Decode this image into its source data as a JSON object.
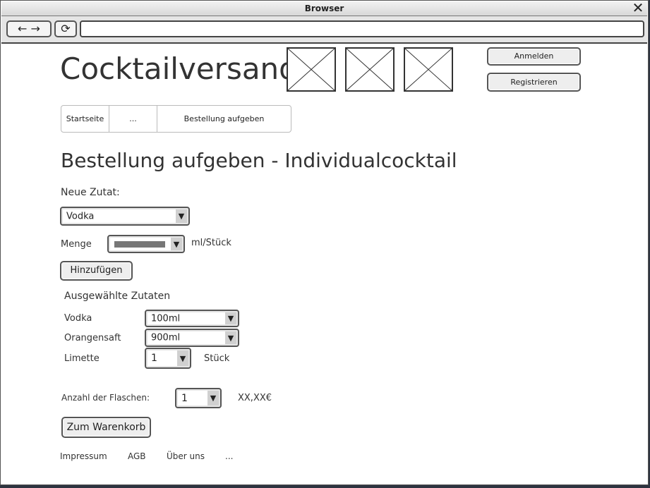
{
  "browser": {
    "title": "Browser",
    "close_glyph": "✕",
    "back_glyph": "←",
    "forward_glyph": "→",
    "reload_glyph": "⟳",
    "url": ""
  },
  "header": {
    "logo": "Cocktailversand",
    "login": "Anmelden",
    "register": "Registrieren"
  },
  "nav": {
    "items": [
      "Startseite",
      "...",
      "Bestellung aufgeben"
    ]
  },
  "main": {
    "title": "Bestellung aufgeben - Individualcocktail",
    "new_ingredient_label": "Neue Zutat:",
    "ingredient_select": "Vodka",
    "amount_label": "Menge",
    "amount_unit": "ml/Stück",
    "add_button": "Hinzufügen",
    "selected_title": "Ausgewählte Zutaten",
    "selected": [
      {
        "name": "Vodka",
        "amount": "100ml",
        "unit": ""
      },
      {
        "name": "Orangensaft",
        "amount": "900ml",
        "unit": ""
      },
      {
        "name": "Limette",
        "amount": "1",
        "unit": "Stück"
      }
    ],
    "bottles_label": "Anzahl der Flaschen:",
    "bottles_value": "1",
    "price": "XX,XX€",
    "cart_button": "Zum Warenkorb"
  },
  "footer": {
    "links": [
      "Impressum",
      "AGB",
      "Über uns",
      "..."
    ]
  }
}
